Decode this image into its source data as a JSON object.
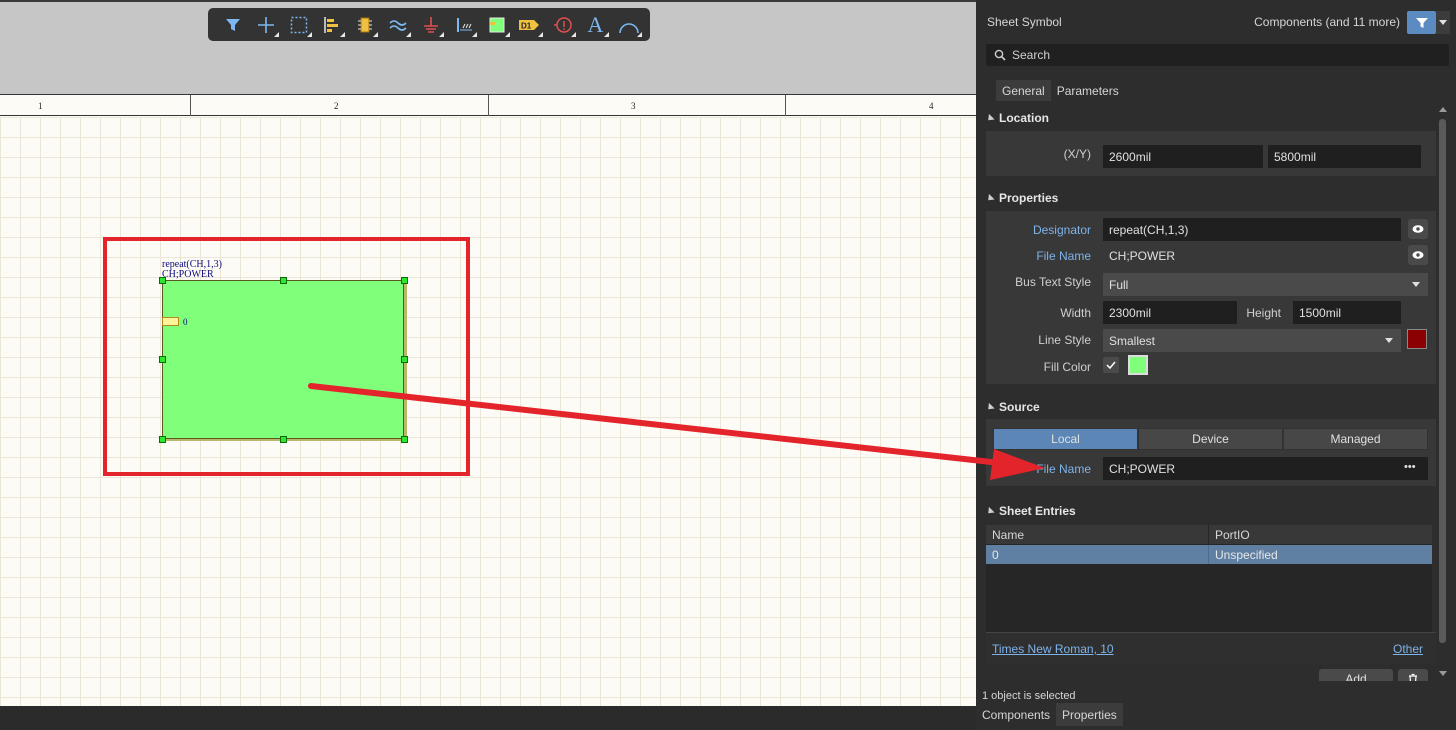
{
  "toolbar": {
    "icons": [
      "filter-icon",
      "crosshair-icon",
      "select-rect-icon",
      "align-icon",
      "component-icon",
      "bus-icon",
      "ground-icon",
      "net-label-icon",
      "sheet-symbol-icon",
      "designator-icon",
      "directive-icon",
      "text-icon",
      "arc-icon"
    ],
    "designator_label": "D1",
    "text_glyph": "A"
  },
  "ruler": {
    "labels": [
      "1",
      "2",
      "3",
      "4"
    ]
  },
  "canvas": {
    "sheet_symbol": {
      "designator": "repeat(CH,1,3)",
      "file_name": "CH;POWER",
      "entry_label": "0",
      "fill_color": "#80ff7a"
    },
    "annotation_color": "#e3242b"
  },
  "panel": {
    "title": "Sheet Symbol",
    "filter_text": "Components (and 11 more)",
    "search_placeholder": "Search",
    "tabs": [
      "General",
      "Parameters"
    ],
    "location": {
      "heading": "Location",
      "xy_label": "(X/Y)",
      "x": "2600mil",
      "y": "5800mil"
    },
    "properties": {
      "heading": "Properties",
      "designator_label": "Designator",
      "designator_value": "repeat(CH,1,3)",
      "file_name_label": "File Name",
      "file_name_value": "CH;POWER",
      "bus_text_style_label": "Bus Text Style",
      "bus_text_style_value": "Full",
      "width_label": "Width",
      "width_value": "2300mil",
      "height_label": "Height",
      "height_value": "1500mil",
      "line_style_label": "Line Style",
      "line_style_value": "Smallest",
      "line_color": "#8b0000",
      "fill_color_label": "Fill Color",
      "fill_color": "#80ff7a"
    },
    "source": {
      "heading": "Source",
      "segments": [
        "Local",
        "Device",
        "Managed"
      ],
      "file_name_label": "File Name",
      "file_name_value": "CH;POWER",
      "more": "•••"
    },
    "sheet_entries": {
      "heading": "Sheet Entries",
      "columns": [
        "Name",
        "PortIO"
      ],
      "rows": [
        {
          "name": "0",
          "portio": "Unspecified"
        }
      ],
      "font_link": "Times New Roman, 10",
      "other_link": "Other",
      "add_button": "Add"
    },
    "status": "1 object is selected",
    "bottom_tabs": [
      "Components",
      "Properties"
    ]
  }
}
